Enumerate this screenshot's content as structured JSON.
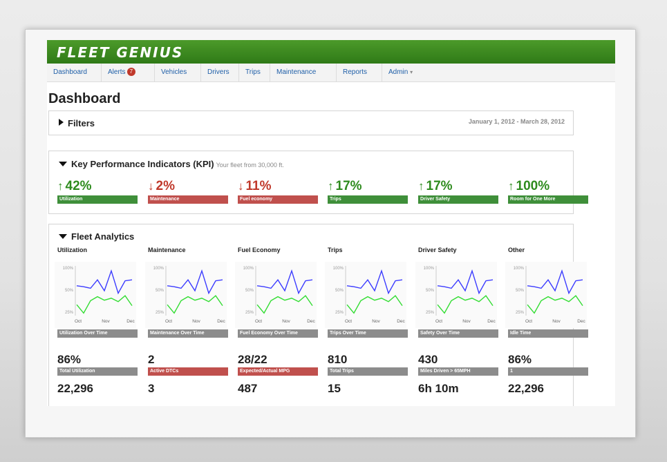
{
  "app": {
    "logo": "FLEET GENIUS",
    "accent": "#3c8c22"
  },
  "nav": [
    {
      "label": "Dashboard"
    },
    {
      "label": "Alerts",
      "badge": "7"
    },
    {
      "label": "Vehicles"
    },
    {
      "label": "Drivers"
    },
    {
      "label": "Trips"
    },
    {
      "label": "Maintenance"
    },
    {
      "label": "Reports"
    },
    {
      "label": "Admin",
      "caret": "▾"
    }
  ],
  "page": {
    "title": "Dashboard"
  },
  "filters": {
    "label": "Filters",
    "date_range": "January 1, 2012 - March 28, 2012"
  },
  "kpi": {
    "title": "Key Performance Indicators (KPI)",
    "subtitle": "Your fleet from 30,000 ft.",
    "items": [
      {
        "value": "42%",
        "label": "Utilization",
        "trend": "up"
      },
      {
        "value": "2%",
        "label": "Maintenance",
        "trend": "down"
      },
      {
        "value": "11%",
        "label": "Fuel economy",
        "trend": "down"
      },
      {
        "value": "17%",
        "label": "Trips",
        "trend": "up"
      },
      {
        "value": "17%",
        "label": "Driver Safety",
        "trend": "up"
      },
      {
        "value": "100%",
        "label": "Room for One More",
        "trend": "up"
      }
    ]
  },
  "analytics": {
    "title": "Fleet Analytics",
    "chart_axis": {
      "y_ticks": [
        "100%",
        "50%",
        "25%"
      ],
      "x_ticks": [
        "Oct",
        "Nov",
        "Dec"
      ]
    },
    "columns": [
      {
        "title": "Utilization",
        "chart_caption": "Utilization Over Time",
        "metric1": "86%",
        "metric1_label": "Total Utilization",
        "metric1_color": "gray",
        "metric2": "22,296"
      },
      {
        "title": "Maintenance",
        "chart_caption": "Maintenance Over Time",
        "metric1": "2",
        "metric1_label": "Active DTCs",
        "metric1_color": "red",
        "metric2": "3"
      },
      {
        "title": "Fuel Economy",
        "chart_caption": "Fuel Economy Over Time",
        "metric1": "28/22",
        "metric1_label": "Expected/Actual MPG",
        "metric1_color": "red",
        "metric2": "487"
      },
      {
        "title": "Trips",
        "chart_caption": "Trips Over Time",
        "metric1": "810",
        "metric1_label": "Total Trips",
        "metric1_color": "gray",
        "metric2": "15"
      },
      {
        "title": "Driver Safety",
        "chart_caption": "Safety Over Time",
        "metric1": "430",
        "metric1_label": "Miles Driven > 65MPH",
        "metric1_color": "gray",
        "metric2": "6h 10m"
      },
      {
        "title": "Other",
        "chart_caption": "Idle Time",
        "metric1": "86%",
        "metric1_label": "1",
        "metric1_color": "gray",
        "metric2": "22,296"
      }
    ]
  },
  "chart_data": {
    "type": "line",
    "x": [
      "Oct",
      "",
      "",
      "Nov",
      "",
      "",
      "",
      "Dec",
      ""
    ],
    "x_ticks": [
      "Oct",
      "Nov",
      "Dec"
    ],
    "y_ticks": [
      "100%",
      "50%",
      "25%"
    ],
    "ylim": [
      0,
      100
    ],
    "series": [
      {
        "color": "#3b3bff",
        "values": [
          60,
          58,
          55,
          72,
          50,
          90,
          45,
          70,
          72
        ]
      },
      {
        "color": "#33dd33",
        "values": [
          22,
          5,
          30,
          38,
          31,
          35,
          28,
          40,
          20
        ]
      }
    ]
  },
  "colors": {
    "up": "#2e8b1e",
    "down": "#c0392b",
    "bar_green": "#3f8f3a",
    "bar_red": "#c0504d",
    "bar_gray": "#8c8c8c"
  }
}
